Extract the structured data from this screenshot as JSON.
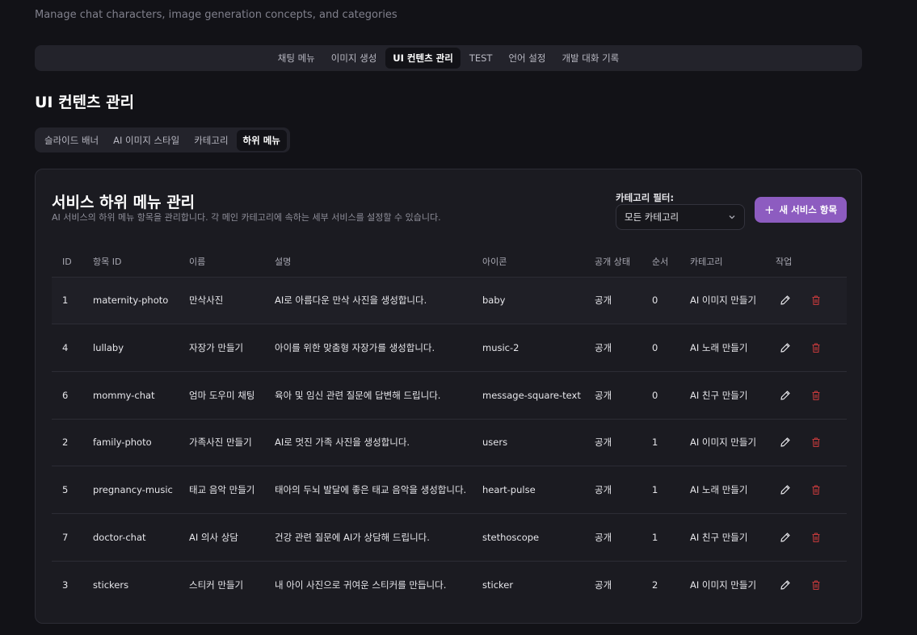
{
  "header": {
    "subtitle": "Manage chat characters, image generation concepts, and categories"
  },
  "topnav": {
    "tabs": [
      {
        "label": "채팅 메뉴"
      },
      {
        "label": "이미지 생성"
      },
      {
        "label": "UI 컨텐츠 관리"
      },
      {
        "label": "TEST"
      },
      {
        "label": "언어 설정"
      },
      {
        "label": "개발 대화 기록"
      }
    ],
    "active_index": 2
  },
  "page": {
    "title": "UI 컨텐츠 관리"
  },
  "subnav": {
    "tabs": [
      {
        "label": "슬라이드 배너"
      },
      {
        "label": "AI 이미지 스타일"
      },
      {
        "label": "카테고리"
      },
      {
        "label": "하위 메뉴"
      }
    ],
    "active_index": 3
  },
  "card": {
    "title": "서비스 하위 메뉴 관리",
    "description": "AI 서비스의 하위 메뉴 항목을 관리합니다. 각 메인 카테고리에 속하는 세부 서비스를 설정할 수 있습니다.",
    "filter_label": "카테고리 필터:",
    "filter_value": "모든 카테고리",
    "add_button": "새 서비스 항목",
    "accent_color": "#8d5cc0",
    "delete_color": "#c0393b"
  },
  "table": {
    "columns": [
      "ID",
      "항목 ID",
      "이름",
      "설명",
      "아이콘",
      "공개 상태",
      "순서",
      "카테고리",
      "작업"
    ],
    "rows": [
      {
        "id": "1",
        "key": "maternity-photo",
        "name": "만삭사진",
        "desc": "AI로 아름다운 만삭 사진을 생성합니다.",
        "icon": "baby",
        "status": "공개",
        "order": "0",
        "category": "AI 이미지 만들기"
      },
      {
        "id": "4",
        "key": "lullaby",
        "name": "자장가 만들기",
        "desc": "아이를 위한 맞춤형 자장가를 생성합니다.",
        "icon": "music-2",
        "status": "공개",
        "order": "0",
        "category": "AI 노래 만들기"
      },
      {
        "id": "6",
        "key": "mommy-chat",
        "name": "엄마 도우미 채팅",
        "desc": "육아 및 임신 관련 질문에 답변해 드립니다.",
        "icon": "message-square-text",
        "status": "공개",
        "order": "0",
        "category": "AI 친구 만들기"
      },
      {
        "id": "2",
        "key": "family-photo",
        "name": "가족사진 만들기",
        "desc": "AI로 멋진 가족 사진을 생성합니다.",
        "icon": "users",
        "status": "공개",
        "order": "1",
        "category": "AI 이미지 만들기"
      },
      {
        "id": "5",
        "key": "pregnancy-music",
        "name": "태교 음악 만들기",
        "desc": "태아의 두뇌 발달에 좋은 태교 음악을 생성합니다.",
        "icon": "heart-pulse",
        "status": "공개",
        "order": "1",
        "category": "AI 노래 만들기"
      },
      {
        "id": "7",
        "key": "doctor-chat",
        "name": "AI 의사 상담",
        "desc": "건강 관련 질문에 AI가 상담해 드립니다.",
        "icon": "stethoscope",
        "status": "공개",
        "order": "1",
        "category": "AI 친구 만들기"
      },
      {
        "id": "3",
        "key": "stickers",
        "name": "스티커 만들기",
        "desc": "내 아이 사진으로 귀여운 스티커를 만듭니다.",
        "icon": "sticker",
        "status": "공개",
        "order": "2",
        "category": "AI 이미지 만들기"
      }
    ]
  }
}
